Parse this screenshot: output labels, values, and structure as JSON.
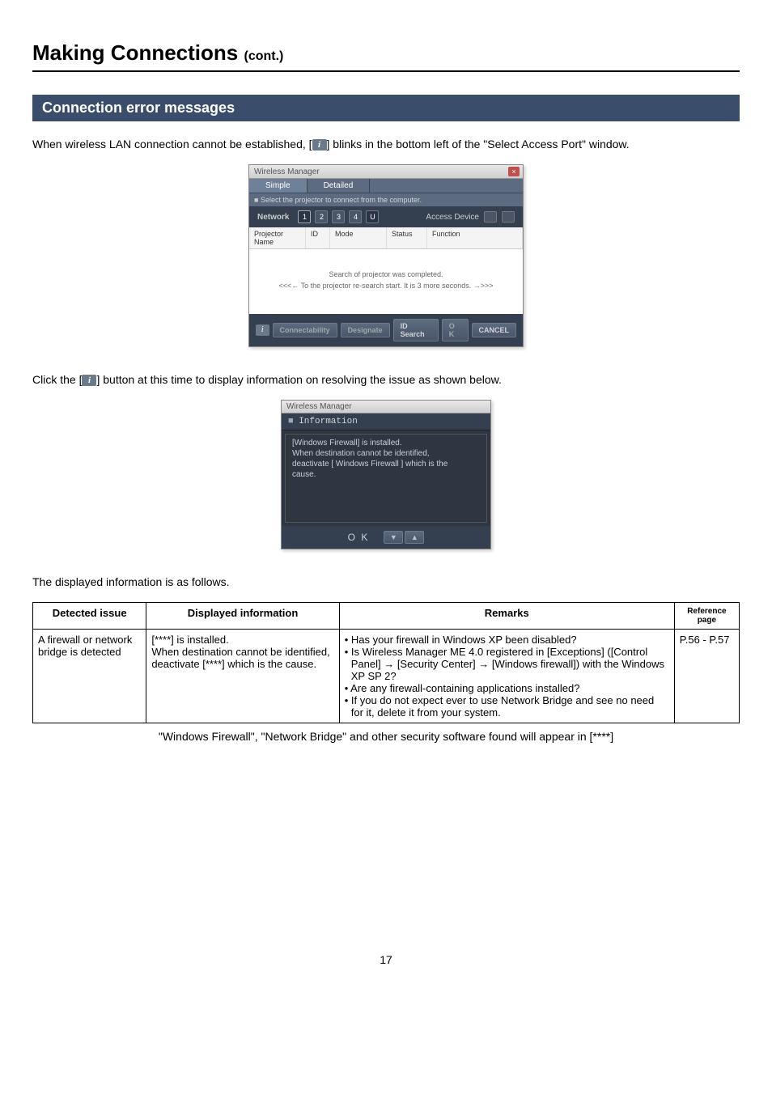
{
  "page": {
    "title_main": "Making Connections",
    "title_cont": "(cont.)",
    "number": "17"
  },
  "section": {
    "header": "Connection error messages",
    "p1a": "When wireless LAN connection cannot be established, [",
    "p1b": "] blinks in the bottom left of the \"Select Access Port\" window.",
    "p2a": "Click the [",
    "p2b": "] button at this time to display information on resolving the issue as shown below.",
    "p3": "The displayed information is as follows.",
    "footnote": "\"Windows Firewall\", \"Network Bridge\" and other security software found will appear in [****]"
  },
  "dialog1": {
    "title": "Wireless Manager",
    "close": "×",
    "tab_simple": "Simple",
    "tab_detailed": "Detailed",
    "instruction": "Select the projector to connect from the computer.",
    "network_label": "Network",
    "net1": "1",
    "net2": "2",
    "net3": "3",
    "net4": "4",
    "netU": "U",
    "access_device": "Access Device",
    "col_name": "Projector Name",
    "col_id": "ID",
    "col_mode": "Mode",
    "col_status": "Status",
    "col_function": "Function",
    "body_line1": "Search of projector was completed.",
    "body_line2": "<<<←  To the projector re-search start. It is 3 more seconds.  →>>>",
    "btn_conn": "Connectability",
    "btn_designate": "Designate",
    "btn_idsearch": "ID Search",
    "btn_ok": "O K",
    "btn_cancel": "CANCEL",
    "info_glyph": "i"
  },
  "dialog2": {
    "title": "Wireless Manager",
    "heading": "Information",
    "body": "[Windows Firewall] is installed.\nWhen destination cannot be identified,\ndeactivate [ Windows Firewall ] which is the\ncause.",
    "ok": "O K",
    "down": "▼",
    "up": "▲"
  },
  "table": {
    "h1": "Detected issue",
    "h2": "Displayed information",
    "h3": "Remarks",
    "h4": "Reference page",
    "row1": {
      "issue": "A firewall or network bridge is detected",
      "info": "[****]  is installed.\nWhen destination cannot be identified, deactivate [****] which is the cause.",
      "remarks": [
        "• Has your firewall in Windows XP been disabled?",
        "• Is Wireless Manager ME 4.0 registered in [Exceptions] ([Control Panel] → [Security Center] → [Windows firewall]) with the Windows XP SP 2?",
        "• Are any firewall-containing applications installed?",
        "• If you do not expect ever to use Network Bridge and see no need for it, delete it from your system."
      ],
      "ref": "P.56 - P.57"
    }
  }
}
